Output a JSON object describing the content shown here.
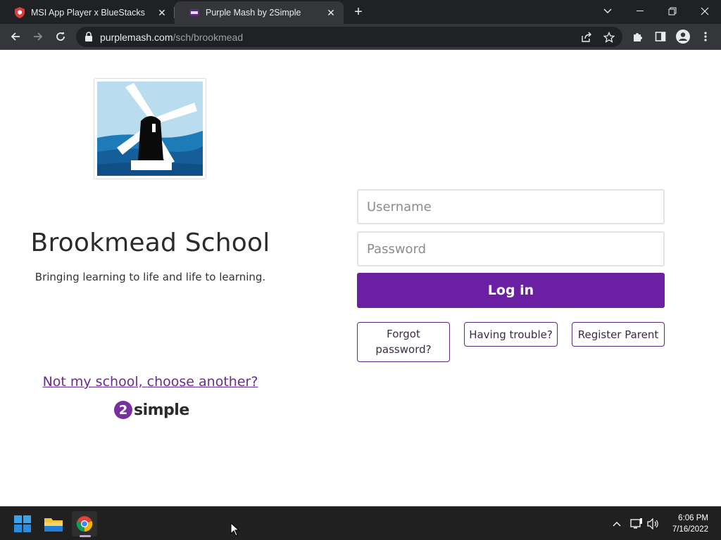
{
  "browser": {
    "tabs": [
      {
        "title": "MSI App Player x BlueStacks",
        "active": false,
        "favicon": "msi-shield-icon"
      },
      {
        "title": "Purple Mash by 2Simple",
        "active": true,
        "favicon": "purple-mash-icon"
      }
    ],
    "address": {
      "domain": "purplemash.com",
      "path": "/sch/brookmead"
    }
  },
  "page": {
    "school_name": "Brookmead School",
    "tagline": "Bringing learning to life and life to learning.",
    "not_my_school": "Not my school, choose another?",
    "brand": {
      "number": "2",
      "word": "simple"
    },
    "login": {
      "username_placeholder": "Username",
      "password_placeholder": "Password",
      "submit_label": "Log in",
      "forgot_label": "Forgot password?",
      "trouble_label": "Having trouble?",
      "register_label": "Register Parent"
    }
  },
  "taskbar": {
    "time": "6:06 PM",
    "date": "7/16/2022"
  },
  "colors": {
    "accent": "#6b1fa3",
    "link": "#6b2a8f",
    "brand_circle": "#7a2fa0"
  }
}
